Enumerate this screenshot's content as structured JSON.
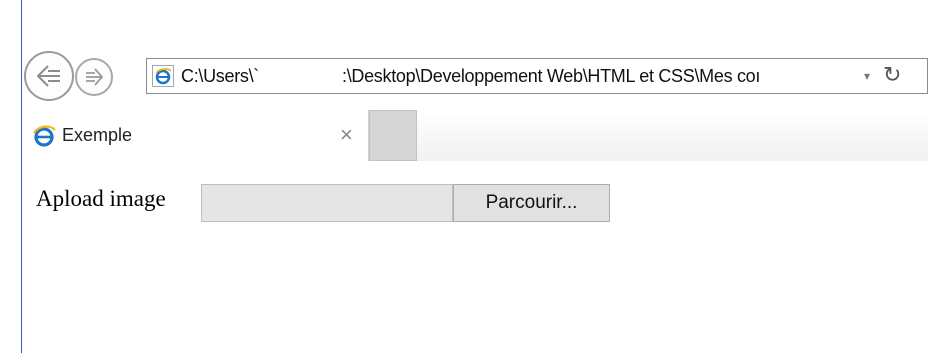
{
  "navigation": {
    "address_part1": "C:\\Users\\`",
    "address_part2": ":\\Desktop\\Developpement Web\\HTML et CSS\\Mes coı",
    "dropdown_glyph": "▾",
    "refresh_glyph": "↻"
  },
  "tabs": {
    "active_tab_title": "Exemple",
    "close_glyph": "×"
  },
  "page": {
    "upload_label": "Apload image",
    "browse_button_label": "Parcourir..."
  },
  "colors": {
    "ie_blue": "#1e74c9",
    "ie_gold": "#f3b824",
    "window_edge": "#3f56c9"
  }
}
